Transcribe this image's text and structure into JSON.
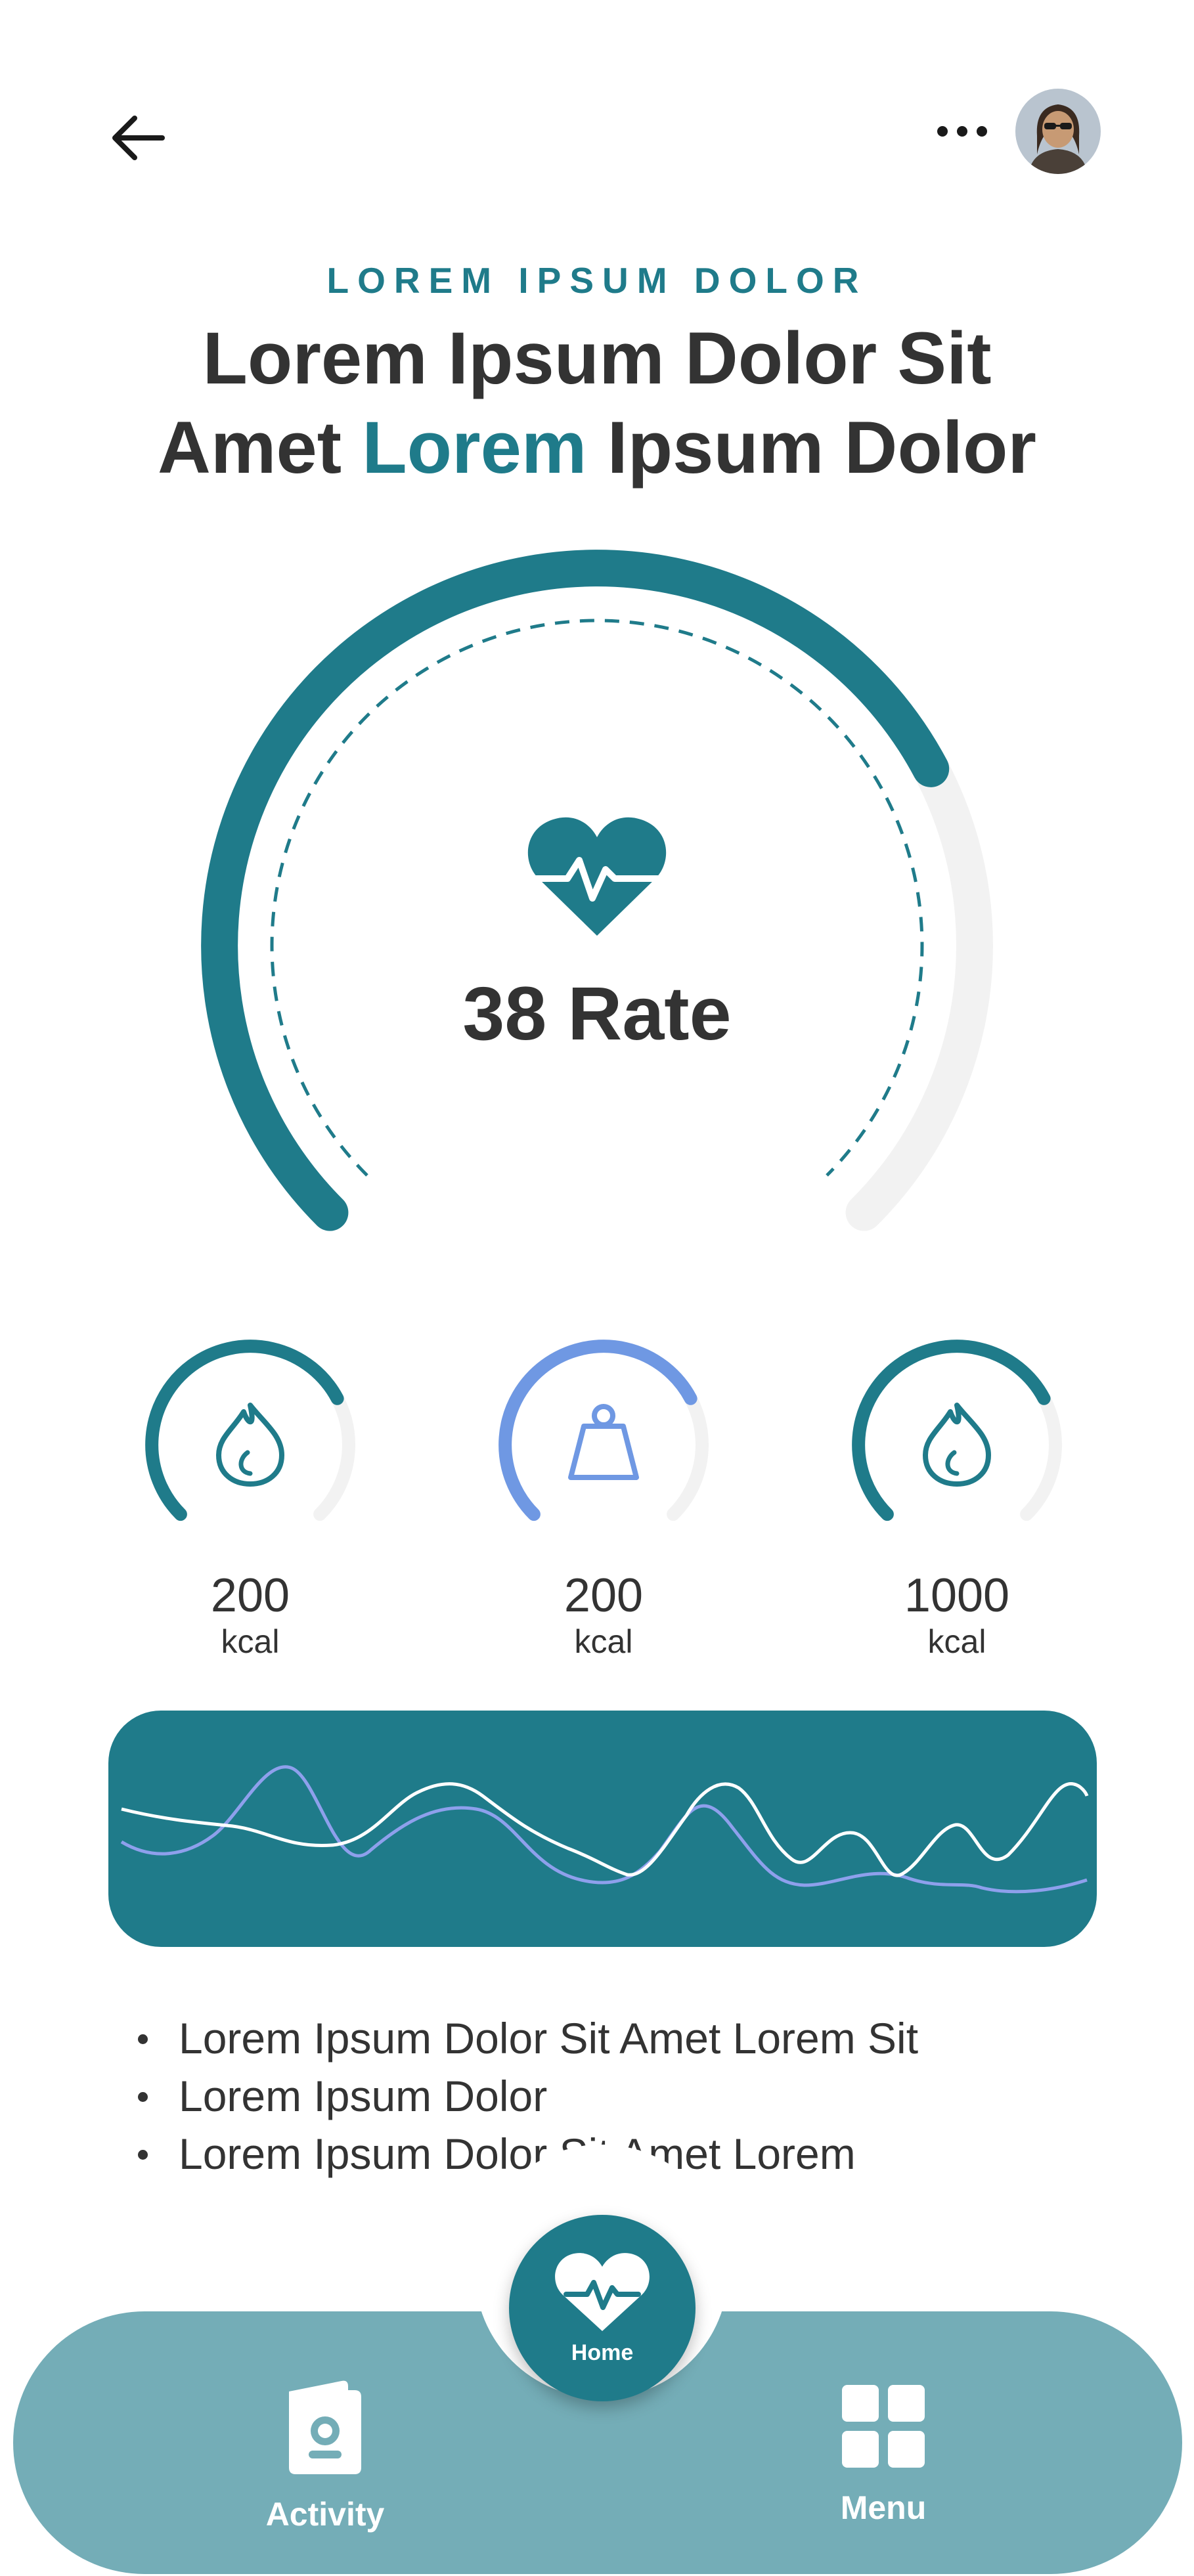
{
  "header": {
    "back_icon": "arrow-left-icon",
    "more_icon": "more-horizontal-icon",
    "avatar_icon": "user-avatar"
  },
  "hero": {
    "eyebrow": "LOREM IPSUM DOLOR",
    "headline_line1": "Lorem Ipsum Dolor Sit",
    "headline_line2_start": "Amet ",
    "headline_line2_accent": "Lorem",
    "headline_line2_end": " Ipsum Dolor"
  },
  "gauge": {
    "icon": "heart-pulse-icon",
    "value_text": "38 Rate",
    "progress": 0.73
  },
  "stats": [
    {
      "icon": "flame-icon",
      "value": "200",
      "unit": "kcal",
      "progress": 0.73,
      "color": "#1f7b8a"
    },
    {
      "icon": "weight-icon",
      "value": "200",
      "unit": "kcal",
      "progress": 0.73,
      "color": "#6f98e3"
    },
    {
      "icon": "flame-icon",
      "value": "1000",
      "unit": "kcal",
      "progress": 0.73,
      "color": "#1f7b8a"
    }
  ],
  "wave_chart": {
    "series": [
      {
        "color": "#ffffff"
      },
      {
        "color": "#8ea0ec"
      }
    ]
  },
  "bullets": [
    "Lorem Ipsum Dolor Sit Amet Lorem Sit",
    "Lorem Ipsum Dolor",
    "Lorem Ipsum Dolor Sit Amet Lorem"
  ],
  "nav": {
    "activity_label": "Activity",
    "activity_icon": "activity-card-icon",
    "home_label": "Home",
    "home_icon": "heart-pulse-icon",
    "menu_label": "Menu",
    "menu_icon": "grid-icon"
  },
  "colors": {
    "primary": "#1f7b8a",
    "secondary": "#6f98e3",
    "nav_bg": "#74adb7",
    "track": "#f2f2f2"
  }
}
